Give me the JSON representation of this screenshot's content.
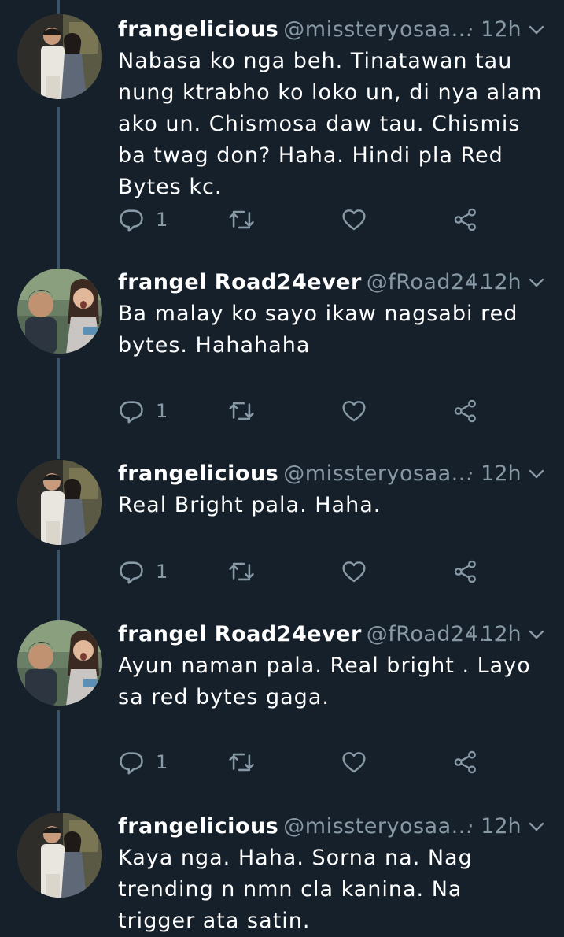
{
  "colors": {
    "background": "#15202b",
    "text": "#ffffff",
    "muted": "#8899a6",
    "thread_line": "#3d5466"
  },
  "tweets": [
    {
      "author_name": "frangelicious",
      "handle": "@missteryosaa...",
      "time": "· 12h",
      "text": "Nabasa ko nga beh. Tinatawan tau nung ktrabho ko loko un, di nya alam ako un. Chismosa daw tau. Chismis ba twag don? Haha. Hindi pla Red Bytes kc.",
      "reply_count": "1",
      "avatar": "avatar-couple-photo"
    },
    {
      "author_name": "frangel Road24ever",
      "handle": "@fRoad24...",
      "time": "· 12h",
      "text": "Ba malay ko sayo ikaw nagsabi red bytes. Hahahaha",
      "reply_count": "1",
      "avatar": "avatar-couple-selfie"
    },
    {
      "author_name": "frangelicious",
      "handle": "@missteryosaa...",
      "time": "· 12h",
      "text": "Real Bright pala. Haha.",
      "reply_count": "1",
      "avatar": "avatar-couple-photo"
    },
    {
      "author_name": "frangel Road24ever",
      "handle": "@fRoad24...",
      "time": "· 12h",
      "text": "Ayun naman pala. Real bright . Layo sa red bytes gaga.",
      "reply_count": "1",
      "avatar": "avatar-couple-selfie"
    },
    {
      "author_name": "frangelicious",
      "handle": "@missteryosaa...",
      "time": "· 12h",
      "text": "Kaya nga. Haha. Sorna na. Nag trending n nmn cla kanina. Na trigger ata satin.",
      "avatar": "avatar-couple-photo"
    }
  ],
  "icons": {
    "reply": "reply-icon",
    "retweet": "retweet-icon",
    "like": "heart-icon",
    "share": "share-icon",
    "caret": "chevron-down-icon"
  }
}
